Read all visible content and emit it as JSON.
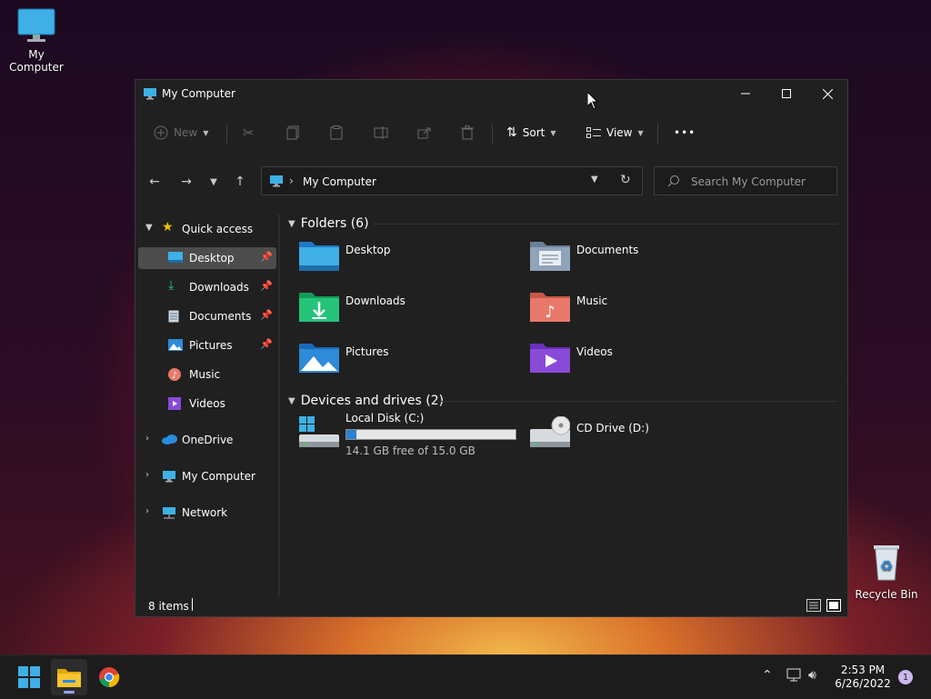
{
  "desktop": {
    "my_computer_label": "My Computer",
    "recycle_bin_label": "Recycle Bin"
  },
  "window": {
    "title": "My Computer",
    "toolbar": {
      "new_label": "New",
      "sort_label": "Sort",
      "view_label": "View",
      "more_label": "•••"
    },
    "address": {
      "crumb": "My Computer"
    },
    "search": {
      "placeholder": "Search My Computer"
    },
    "sidebar": {
      "quick_access": "Quick access",
      "items": [
        {
          "label": "Desktop",
          "pinned": true,
          "selected": true
        },
        {
          "label": "Downloads",
          "pinned": true
        },
        {
          "label": "Documents",
          "pinned": true
        },
        {
          "label": "Pictures",
          "pinned": true
        },
        {
          "label": "Music"
        },
        {
          "label": "Videos"
        }
      ],
      "onedrive": "OneDrive",
      "my_computer": "My Computer",
      "network": "Network"
    },
    "folders_header": "Folders (6)",
    "folders": [
      {
        "label": "Desktop"
      },
      {
        "label": "Documents"
      },
      {
        "label": "Downloads"
      },
      {
        "label": "Music"
      },
      {
        "label": "Pictures"
      },
      {
        "label": "Videos"
      }
    ],
    "drives_header": "Devices and drives (2)",
    "drives": [
      {
        "label": "Local Disk (C:)",
        "free_text": "14.1 GB free of 15.0 GB",
        "used_fraction": 0.06
      },
      {
        "label": "CD Drive (D:)"
      }
    ],
    "status": {
      "item_count": "8 items"
    }
  },
  "taskbar": {
    "time": "2:53 PM",
    "date": "6/26/2022",
    "notification_count": "1"
  },
  "colors": {
    "accent": "#2d7fd0",
    "window_bg": "#202020",
    "selected_bg": "#4c4c4c"
  }
}
